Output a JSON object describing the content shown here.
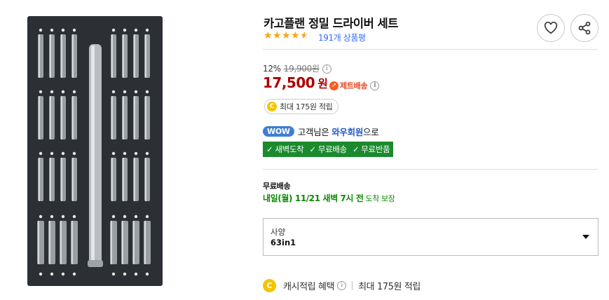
{
  "product": {
    "title": "카고플랜 정밀 드라이버 세트",
    "rating": 4.5,
    "review_count_label": "191개 상품평",
    "image_icon": "screwdriver-set-image"
  },
  "pricing": {
    "discount_rate": "12%",
    "original_price": "19,900원",
    "sale_price": "17,500",
    "currency_suffix": "원",
    "rocket_label": "제트배송",
    "cashback_badge": "최대 175원 적립",
    "coin_glyph": "C"
  },
  "wow": {
    "badge": "WOW",
    "text_prefix": "고객님은 ",
    "link": "와우회원",
    "text_suffix": "으로",
    "benefits": [
      "새벽도착",
      "무료배송",
      "무료반품"
    ]
  },
  "shipping": {
    "label": "무료배송",
    "date": "내일(월) 11/21 새벽 7시 전",
    "guarantee": "도착 보장"
  },
  "option": {
    "label": "사양",
    "value": "63in1"
  },
  "cash_benefit": {
    "label": "캐시적립 혜택",
    "max": "최대 175원 적립"
  },
  "icons": [
    "heart-icon",
    "share-icon",
    "info-icon",
    "rocket-icon",
    "coin-icon",
    "chevron-down-icon"
  ],
  "colors": {
    "price_red": "#ae0000",
    "review_blue": "#346aff",
    "star_orange": "#f6a614",
    "green": "#1b8a2d",
    "wow_blue": "#3f7ed4"
  }
}
